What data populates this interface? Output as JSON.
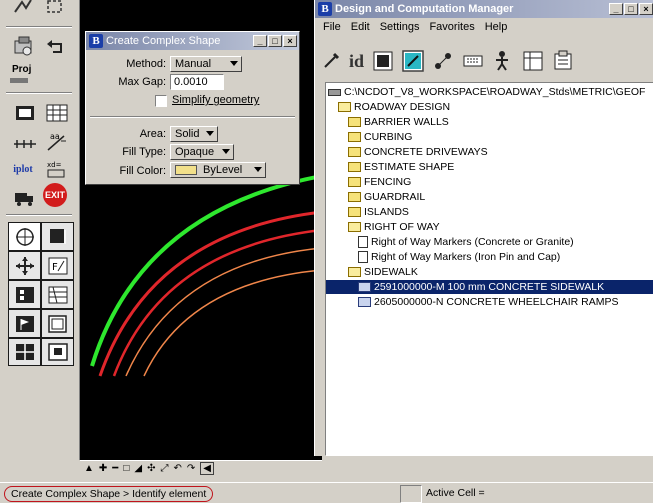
{
  "create_shape_dialog": {
    "title": "Create Complex Shape",
    "method_label": "Method:",
    "method_value": "Manual",
    "max_gap_label": "Max Gap:",
    "max_gap_value": "0.0010",
    "simplify_label": "Simplify geometry",
    "area_label": "Area:",
    "area_value": "Solid",
    "fill_type_label": "Fill Type:",
    "fill_type_value": "Opaque",
    "fill_color_label": "Fill Color:",
    "fill_color_value": "ByLevel"
  },
  "manager": {
    "title": "Design and Computation Manager",
    "menus": [
      "File",
      "Edit",
      "Settings",
      "Favorites",
      "Help"
    ],
    "tree": [
      {
        "label": "C:\\NCDOT_V8_WORKSPACE\\ROADWAY_Stds\\METRIC\\GEOF",
        "icon": "drive-icon",
        "indent": 0
      },
      {
        "label": "ROADWAY DESIGN",
        "icon": "folder-open-icon",
        "indent": 1
      },
      {
        "label": "BARRIER WALLS",
        "icon": "folder-icon",
        "indent": 2
      },
      {
        "label": "CURBING",
        "icon": "folder-icon",
        "indent": 2
      },
      {
        "label": "CONCRETE DRIVEWAYS",
        "icon": "folder-icon",
        "indent": 2
      },
      {
        "label": "ESTIMATE SHAPE",
        "icon": "folder-icon",
        "indent": 2
      },
      {
        "label": "FENCING",
        "icon": "folder-icon",
        "indent": 2
      },
      {
        "label": "GUARDRAIL",
        "icon": "folder-icon",
        "indent": 2
      },
      {
        "label": "ISLANDS",
        "icon": "folder-icon",
        "indent": 2
      },
      {
        "label": "RIGHT OF WAY",
        "icon": "folder-open-icon",
        "indent": 2
      },
      {
        "label": "Right of Way Markers (Concrete or Granite)",
        "icon": "document-icon",
        "indent": 3
      },
      {
        "label": "Right of Way Markers (Iron Pin and Cap)",
        "icon": "document-icon",
        "indent": 3
      },
      {
        "label": "SIDEWALK",
        "icon": "folder-open-icon",
        "indent": 2
      },
      {
        "label": "2591000000-M 100 mm CONCRETE SIDEWALK",
        "icon": "cell-icon",
        "indent": 3,
        "selected": true
      },
      {
        "label": "2605000000-N CONCRETE WHEELCHAIR RAMPS",
        "icon": "cell-icon",
        "indent": 3
      }
    ]
  },
  "palette": {
    "proj_label": "Proj",
    "iplot_label": "iplot",
    "exit_label": "EXIT"
  },
  "status_bar": {
    "message": "Create Complex Shape > Identify element",
    "active_cell_label": "Active Cell ="
  },
  "colors": {
    "curve_outer": "#2ee82e",
    "curve_middle": "#e0262b",
    "curve_inner": "#f0864a",
    "selection": "#0a246a",
    "highlight_ring": "#c0141c"
  }
}
